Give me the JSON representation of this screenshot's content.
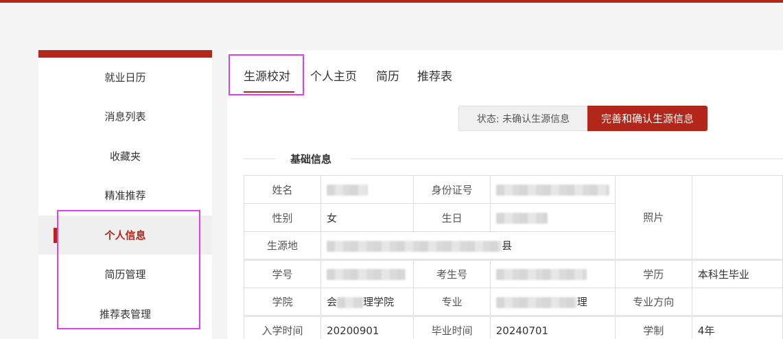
{
  "colors": {
    "accent": "#b3271b",
    "highlight": "#e43cf0"
  },
  "sidebar": {
    "items": [
      {
        "label": "就业日历"
      },
      {
        "label": "消息列表"
      },
      {
        "label": "收藏夹"
      },
      {
        "label": "精准推荐"
      },
      {
        "label": "个人信息",
        "active": true
      },
      {
        "label": "简历管理"
      },
      {
        "label": "推荐表管理"
      }
    ]
  },
  "tabs": [
    {
      "label": "生源校对",
      "active": true
    },
    {
      "label": "个人主页"
    },
    {
      "label": "简历"
    },
    {
      "label": "推荐表"
    }
  ],
  "status": {
    "text": "状态: 未确认生源信息"
  },
  "confirm_button": {
    "label": "完善和确认生源信息"
  },
  "section": {
    "title": "基础信息"
  },
  "table": {
    "name_label": "姓名",
    "id_label": "身份证号",
    "photo_label": "照片",
    "gender_label": "性别",
    "gender_value": "女",
    "birthday_label": "生日",
    "origin_label": "生源地",
    "origin_suffix": "县",
    "student_no_label": "学号",
    "exam_no_label": "考生号",
    "education_label": "学历",
    "education_value": "本科生毕业",
    "college_label": "学院",
    "college_prefix": "会",
    "college_suffix": "理学院",
    "major_label": "专业",
    "major_suffix": "理",
    "major_direction_label": "专业方向",
    "major_direction_value": "",
    "enroll_label": "入学时间",
    "enroll_value": "20200901",
    "graduate_label": "毕业时间",
    "graduate_value": "20240701",
    "duration_label": "学制",
    "duration_value": "4年"
  }
}
